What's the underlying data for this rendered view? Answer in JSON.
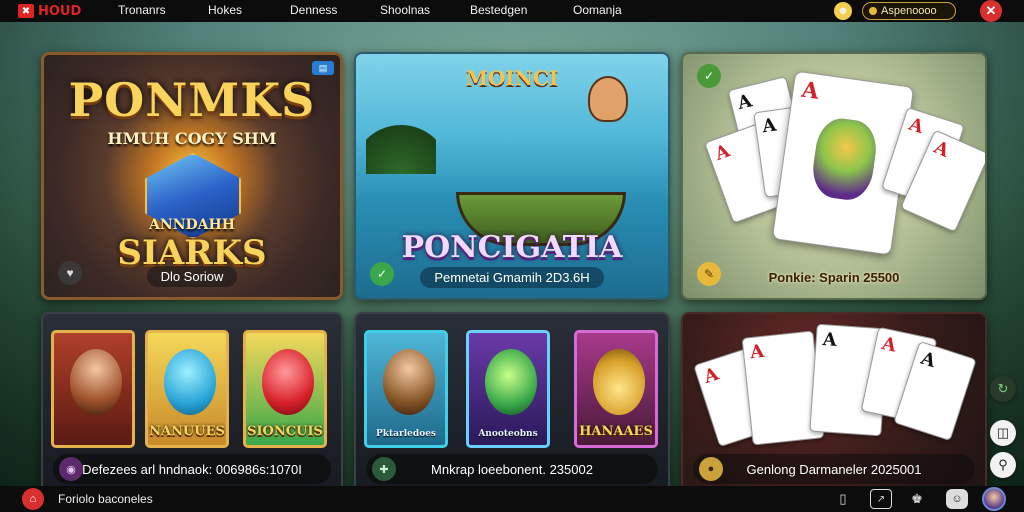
{
  "header": {
    "logo_text": "HOUD",
    "nav": [
      "Tronanrs",
      "Hokes",
      "Denness",
      "Shoolnas",
      "Bestedgen",
      "Oomanja"
    ],
    "balance": "Aspenoooo"
  },
  "cards": [
    {
      "title": "PONMKS",
      "subtitle": "HMUH COGY SHM",
      "small_title": "ANNDAHH",
      "big_title": "SIARKS",
      "caption": "Dlo Soriow"
    },
    {
      "title": "MOINCI",
      "name": "PONCIGATIA",
      "caption": "Pemnetai Gmamih 2D3.6H"
    },
    {
      "caption": "Ponkie: Sparin 25500",
      "card_ranks": [
        "A",
        "A",
        "A",
        "A",
        "A",
        "A"
      ]
    }
  ],
  "strips": [
    {
      "tiles": [
        {
          "label": ""
        },
        {
          "label": "NANUUES"
        },
        {
          "label": "SIONCUIS"
        }
      ],
      "caption": "Defezees arl hndnaok: 006986s:1070I"
    },
    {
      "tiles": [
        {
          "label": "Pktarledoes"
        },
        {
          "label": "Anooteobns"
        },
        {
          "label": "HANAAES"
        }
      ],
      "caption": "Mnkrap loeebonent. 235002"
    },
    {
      "caption": "Genlong Darmaneler 2025001",
      "card_ranks": [
        "A",
        "A",
        "A",
        "A",
        "A"
      ]
    }
  ],
  "footer": {
    "label": "Foriolo baconeles"
  },
  "colors": {
    "accent_red": "#e02424",
    "gold": "#f8d45c",
    "topbar_bg": "#0c0c0c"
  }
}
